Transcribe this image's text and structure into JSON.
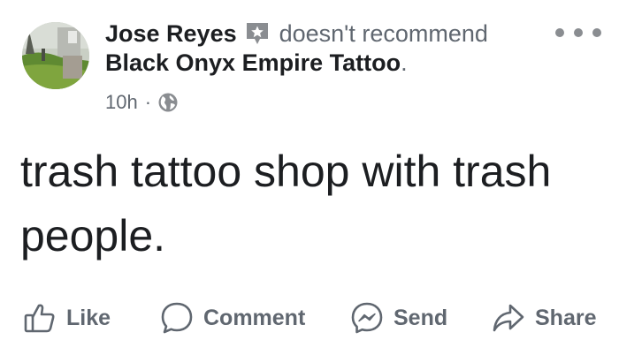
{
  "post": {
    "author": "Jose Reyes",
    "verb": "doesn't recommend",
    "page_name": "Black Onyx Empire Tattoo",
    "page_name_suffix": ".",
    "time": "10h",
    "separator": "·",
    "body": "trash tattoo shop with trash people.",
    "icons": {
      "avatar": "avatar-photo",
      "recommendation": "star-badge-icon",
      "audience": "globe-icon",
      "more": "more-dots-icon"
    }
  },
  "actions": [
    {
      "label": "Like",
      "icon": "thumbs-up-icon"
    },
    {
      "label": "Comment",
      "icon": "comment-bubble-icon"
    },
    {
      "label": "Send",
      "icon": "messenger-icon"
    },
    {
      "label": "Share",
      "icon": "share-arrow-icon"
    }
  ],
  "colors": {
    "text_primary": "#1c1e21",
    "text_secondary": "#606770",
    "icon_gray": "#8a8d91",
    "background": "#ffffff"
  }
}
